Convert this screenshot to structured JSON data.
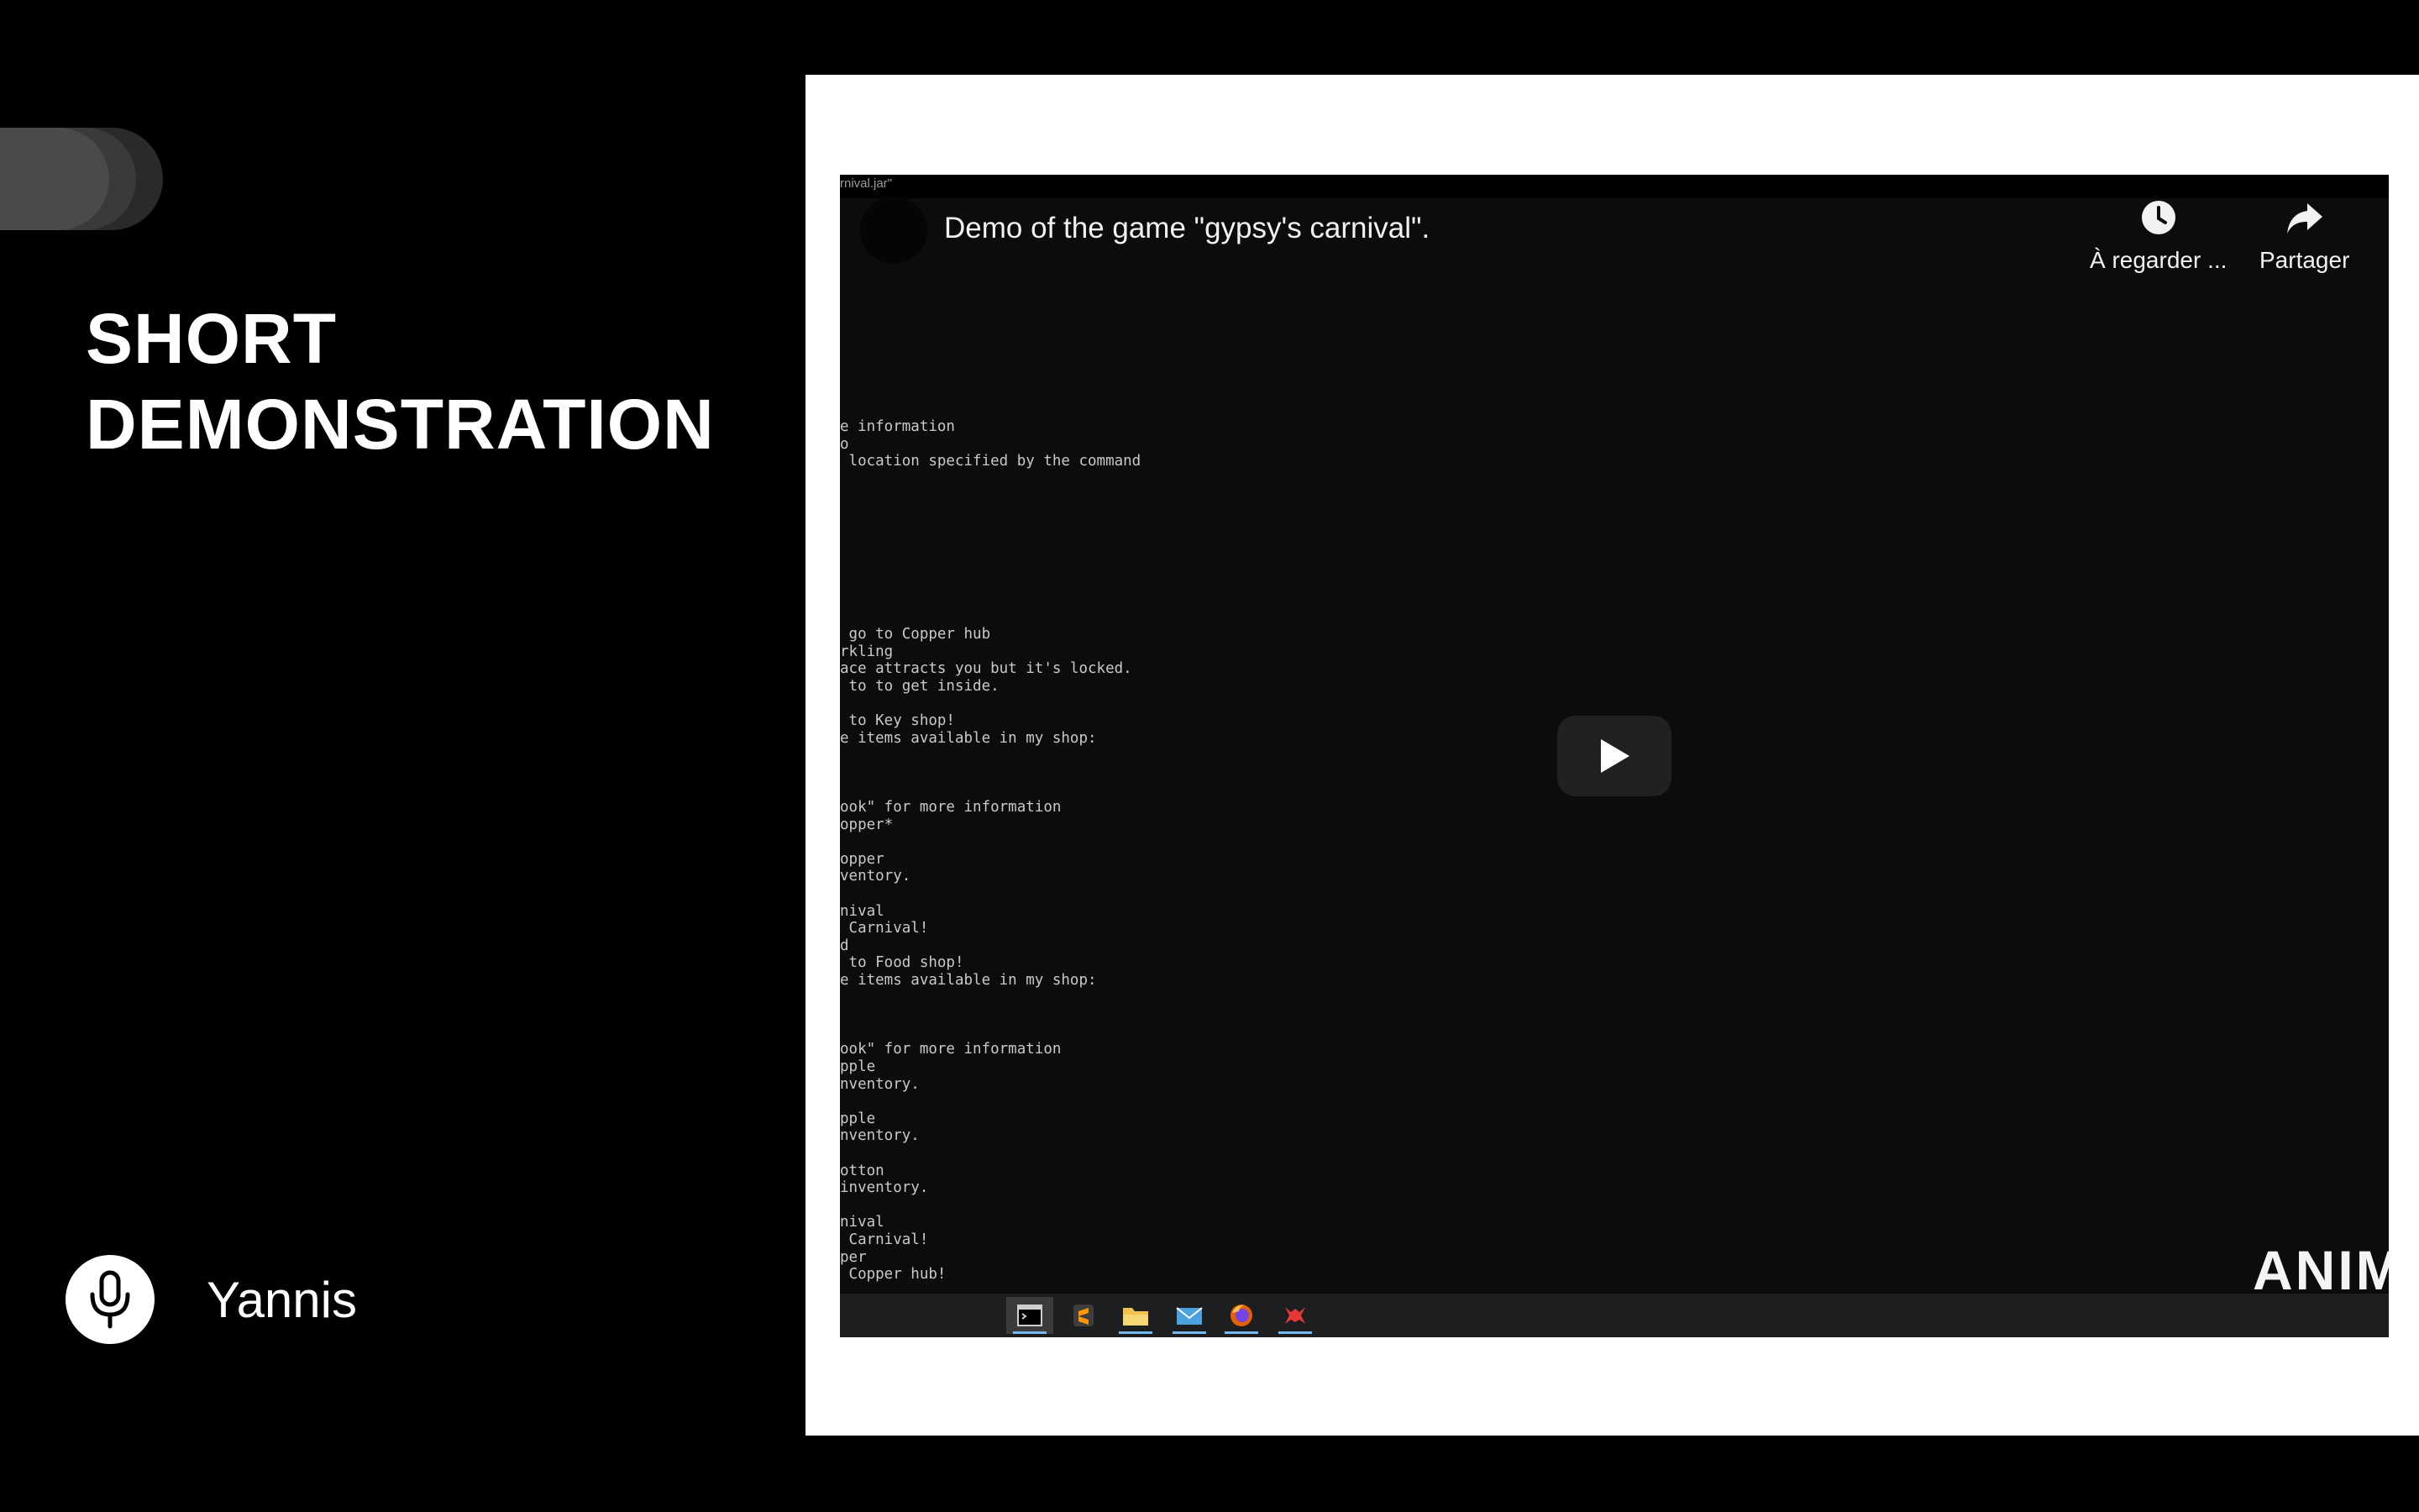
{
  "slide": {
    "title_lines": [
      "SHORT",
      "DEMONSTRATION"
    ],
    "presenter": "Yannis"
  },
  "player": {
    "window_title": "rnival.jar\"",
    "video_title": "Demo of the game \"gypsy's carnival\".",
    "actions": [
      {
        "icon": "clock-icon",
        "label": "À regarder ..."
      },
      {
        "icon": "share-icon",
        "label": "Partager"
      }
    ],
    "terminal_text": "e information\no\n location specified by the command\n\n\n\n\n\n\n\n\n\n go to Copper hub\nrkling\nace attracts you but it's locked.\n to to get inside.\n\n to Key shop!\ne items available in my shop:\n\n\n\nook\" for more information\nopper*\n\nopper\nventory.\n\nnival\n Carnival!\nd\n to Food shop!\ne items available in my shop:\n\n\n\nook\" for more information\npple\nnventory.\n\npple\nnventory.\n\notton\ninventory.\n\nnival\n Carnival!\nper\n Copper hub!",
    "watermark": "ANIM",
    "taskbar": [
      "terminal-icon",
      "sublime-text-icon",
      "file-explorer-icon",
      "mail-icon",
      "firefox-icon",
      "game-icon"
    ]
  },
  "colors": {
    "background": "#000000",
    "frame": "#ffffff",
    "video_bg": "#0b0c0c",
    "terminal_text": "#c9c9c9",
    "taskbar_accent": "#76b9ed"
  }
}
